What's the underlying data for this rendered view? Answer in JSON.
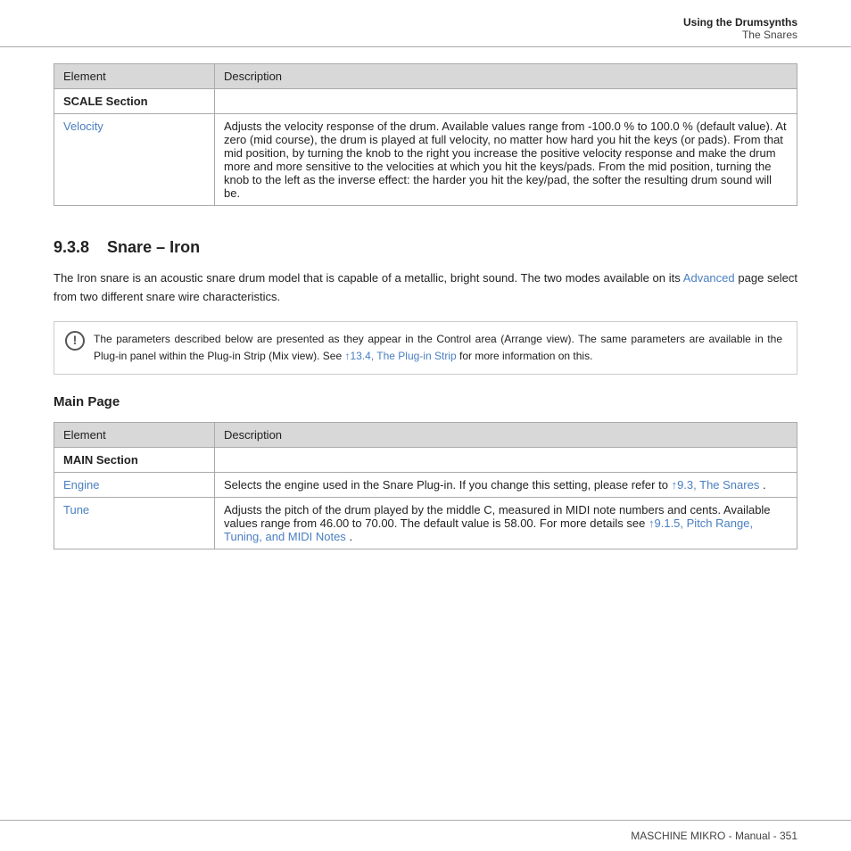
{
  "header": {
    "title_bold": "Using the Drumsynths",
    "subtitle": "The Snares"
  },
  "table1": {
    "col1": "Element",
    "col2": "Description",
    "section_row": {
      "label": "SCALE Section"
    },
    "rows": [
      {
        "element": "Velocity",
        "element_is_link": true,
        "description": "Adjusts the velocity response of the drum. Available values range from -100.0 % to 100.0 % (default value). At zero (mid course), the drum is played at full velocity, no matter how hard you hit the keys (or pads). From that mid position, by turning the knob to the right you increase the positive velocity response and make the drum more and more sensitive to the velocities at which you hit the keys/pads. From the mid position, turning the knob to the left as the inverse effect: the harder you hit the key/pad, the softer the resulting drum sound will be."
      }
    ]
  },
  "section938": {
    "number": "9.3.8",
    "title": "Snare – Iron"
  },
  "intro_text": "The Iron snare is an acoustic snare drum model that is capable of a metallic, bright sound. The two modes available on its",
  "intro_link": "Advanced",
  "intro_text2": "page select from two different snare wire characteristics.",
  "info_box": {
    "icon": "!",
    "text1": "The parameters described below are presented as they appear in the Control area (Arrange view). The same parameters are available in the Plug-in panel within the Plug-in Strip (Mix view). See",
    "link_text": "↑13.4, The Plug-in Strip",
    "text2": "for more information on this."
  },
  "main_page_heading": "Main Page",
  "table2": {
    "col1": "Element",
    "col2": "Description",
    "section_row": {
      "label": "MAIN Section"
    },
    "rows": [
      {
        "element": "Engine",
        "element_is_link": true,
        "description_before": "Selects the engine used in the Snare Plug-in. If you change this setting, please refer to",
        "link_text": "↑9.3, The Snares",
        "description_after": "."
      },
      {
        "element": "Tune",
        "element_is_link": true,
        "description_before": "Adjusts the pitch of the drum played by the middle C, measured in MIDI note numbers and cents. Available values range from 46.00 to 70.00. The default value is 58.00. For more details see",
        "link_text": "↑9.1.5, Pitch Range, Tuning, and MIDI Notes",
        "description_after": "."
      }
    ]
  },
  "footer": {
    "text": "MASCHINE MIKRO - Manual - 351"
  }
}
